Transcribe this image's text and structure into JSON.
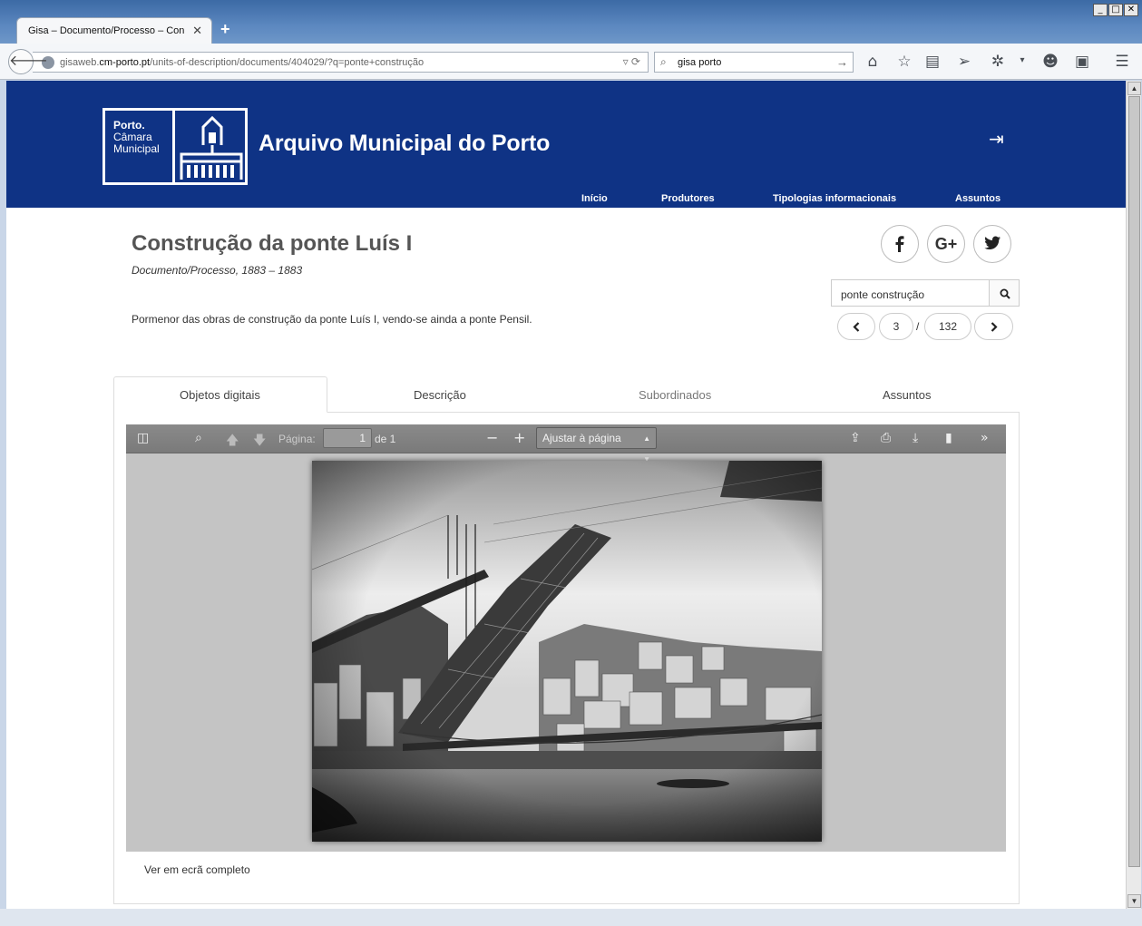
{
  "browser": {
    "tab_title": "Gisa – Documento/Processo – Con...",
    "tab_close": "✕",
    "new_tab": "+",
    "url_prefix": "gisaweb.",
    "url_domain": "cm-porto.pt",
    "url_path": "/units-of-description/documents/404029/?q=ponte+construção",
    "search_value": "gisa porto",
    "window_controls": [
      "_",
      "□",
      "✕"
    ]
  },
  "site": {
    "logo_line1": "Porto.",
    "logo_line2": "Câmara",
    "logo_line3": "Municipal",
    "title": "Arquivo Municipal do Porto",
    "nav": [
      "Início",
      "Produtores",
      "Tipologias informacionais",
      "Assuntos"
    ],
    "brand_color": "#0f3385"
  },
  "document": {
    "title": "Construção da ponte Luís I",
    "meta": "Documento/Processo, 1883 – 1883",
    "description": "Pormenor das obras de construção da ponte Luís I, vendo-se ainda a ponte Pensil.",
    "search_value": "ponte construção",
    "pager_current": "3",
    "pager_separator": "/",
    "pager_total": "132",
    "share": [
      "facebook-icon",
      "google-plus-icon",
      "twitter-icon"
    ],
    "google_plus_label": "G+"
  },
  "tabs": [
    "Objetos digitais",
    "Descrição",
    "Subordinados",
    "Assuntos"
  ],
  "pdf_viewer": {
    "page_label": "Página:",
    "page_value": "1",
    "page_of": "de 1",
    "zoom_value": "Ajustar à página"
  },
  "fullscreen_link": "Ver em ecrã completo"
}
